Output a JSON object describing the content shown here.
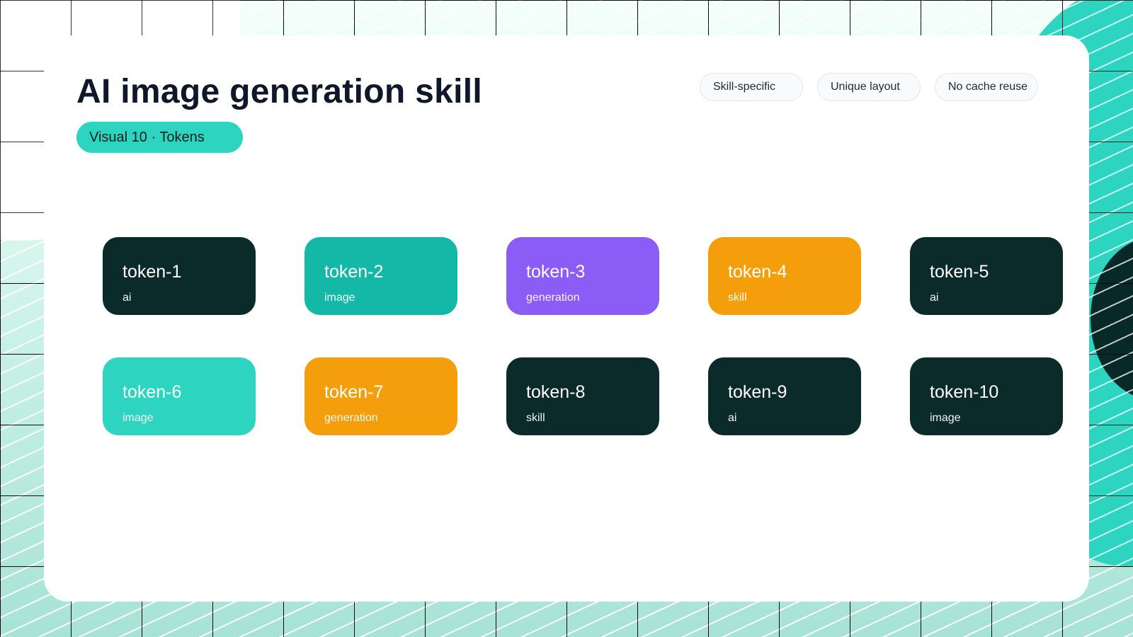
{
  "title": "AI image generation skill",
  "subtitle": "Visual 10 · Tokens",
  "chips": [
    "Skill-specific",
    "Unique layout",
    "No cache reuse"
  ],
  "colors": {
    "dark": "#0b2b2a",
    "teal": "#14b8a6",
    "purple": "#8b5cf6",
    "amber": "#f59e0b",
    "aqua": "#2dd4bf",
    "accent": "#2dd4bf"
  },
  "tokens": [
    {
      "name": "token-1",
      "word": "ai",
      "color": "#0b2b2a"
    },
    {
      "name": "token-2",
      "word": "image",
      "color": "#14b8a6"
    },
    {
      "name": "token-3",
      "word": "generation",
      "color": "#8b5cf6"
    },
    {
      "name": "token-4",
      "word": "skill",
      "color": "#f59e0b"
    },
    {
      "name": "token-5",
      "word": "ai",
      "color": "#0b2b2a"
    },
    {
      "name": "token-6",
      "word": "image",
      "color": "#2dd4bf"
    },
    {
      "name": "token-7",
      "word": "generation",
      "color": "#f59e0b"
    },
    {
      "name": "token-8",
      "word": "skill",
      "color": "#0b2b2a"
    },
    {
      "name": "token-9",
      "word": "ai",
      "color": "#0b2b2a"
    },
    {
      "name": "token-10",
      "word": "image",
      "color": "#0b2b2a"
    }
  ]
}
